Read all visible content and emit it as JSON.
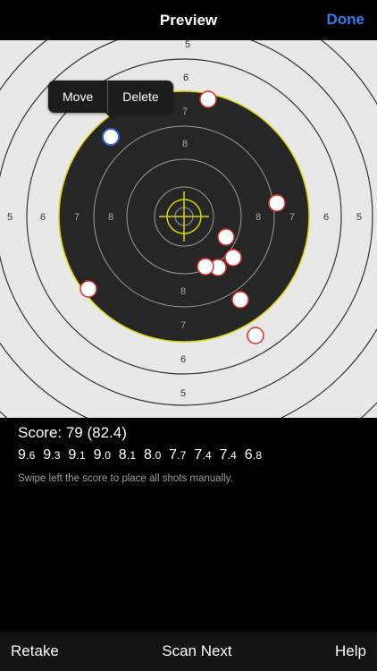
{
  "navbar": {
    "title": "Preview",
    "done_label": "Done",
    "accent_color": "#2f7cf6"
  },
  "target": {
    "ring_labels_outer": [
      "5",
      "6",
      "7"
    ],
    "ring_labels_inner": [
      "7",
      "8"
    ],
    "popover": {
      "move_label": "Move",
      "delete_label": "Delete"
    },
    "highlight_color": "#d8d400",
    "shot_ring_color": "#e03030",
    "selected_shot_color": "#3a62d6"
  },
  "score": {
    "label": "Score: 79 (82.4)",
    "shots": [
      {
        "int": "9",
        "dec": ".6"
      },
      {
        "int": "9",
        "dec": ".3"
      },
      {
        "int": "9",
        "dec": ".1"
      },
      {
        "int": "9",
        "dec": ".0"
      },
      {
        "int": "8",
        "dec": ".1"
      },
      {
        "int": "8",
        "dec": ".0"
      },
      {
        "int": "7",
        "dec": ".7"
      },
      {
        "int": "7",
        "dec": ".4"
      },
      {
        "int": "7",
        "dec": ".4"
      },
      {
        "int": "6",
        "dec": ".8"
      }
    ],
    "hint": "Swipe left the score to place all shots manually."
  },
  "toolbar": {
    "retake_label": "Retake",
    "scan_next_label": "Scan Next",
    "help_label": "Help"
  }
}
